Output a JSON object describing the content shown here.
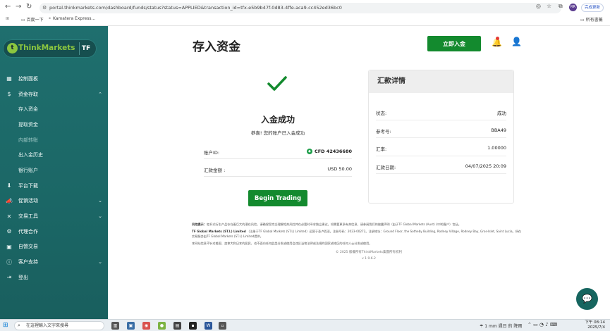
{
  "browser": {
    "url": "portal.thinkmarkets.com/dashboard/funds/status?status=APPLIED&transaction_id=tfx-e5b9b47f-0d83-4ffe-aca9-cc452ed36bc0",
    "bookmarks": [
      "百度一下",
      "Kamatera Express..."
    ],
    "bookmarks_right": "所有書籤",
    "update_label": "完成更新",
    "profile_initial": "RR"
  },
  "sidebar": {
    "brand": "ThinkMarkets",
    "brand_mark": "TF",
    "items": [
      {
        "label": "控制面板",
        "icon": "▦"
      },
      {
        "label": "资金存取",
        "icon": "$",
        "chevron": "⌃"
      },
      {
        "label": "存入资金"
      },
      {
        "label": "提取资金"
      },
      {
        "label": "内部转账"
      },
      {
        "label": "出入金历史"
      },
      {
        "label": "银行账户"
      },
      {
        "label": "平台下载",
        "icon": "⬇"
      },
      {
        "label": "促销活动",
        "icon": "📣",
        "chevron": "⌄"
      },
      {
        "label": "交易工具",
        "icon": "✕",
        "chevron": "⌄"
      },
      {
        "label": "代理合作",
        "icon": "⚙"
      },
      {
        "label": "自營交易",
        "icon": "▣"
      },
      {
        "label": "客户支持",
        "icon": "ⓘ",
        "chevron": "⌄"
      },
      {
        "label": "登出",
        "icon": "⇥"
      }
    ]
  },
  "header": {
    "title": "存入资金",
    "deposit_button": "立即入金"
  },
  "result": {
    "title": "入金成功",
    "message": "恭喜! 您的账户已入金成功",
    "account_label": "账户ID:",
    "account_value": "CFD 42436680",
    "amount_label": "汇款金额 :",
    "amount_value": "USD 50.00",
    "button": "Begin Trading"
  },
  "details": {
    "title": "汇款详情",
    "rows": [
      {
        "k": "状态:",
        "v": "成功"
      },
      {
        "k": "参考号:",
        "v": "BBA49"
      },
      {
        "k": "汇率:",
        "v": "1.00000"
      },
      {
        "k": "汇款日期:",
        "v": "04/07/2025 20:09"
      }
    ]
  },
  "disclaimer": {
    "p1_lead": "风险提示：",
    "p1": "杠杆式衍生产品存在着巨大的潜在风险，请确保您完全理解相关风险并在必要时寻求独立建议。如需要更多有关信息，请参阅我们的披露声明（由于TF Global Markets (Aust) Ltd的客户）包括。",
    "p2_lead": "TF Global Markets (ST.L) Limited",
    "p2": "（注册于TF Global Markets (ST.L) Limited）运营于圣卢西亚。注册号码：2023-00272。注册地址：Ground Floor, the Sotheby Building, Rodney Village, Rodney Bay, Gros-Islet, Saint Lucia。所在交易服务由TF Global Markets (ST.L) Limited提供。",
    "p3": "本网站信息不针对美国、加拿大和日本的居民，也不面向任何此类分发或使用会违反当地法律或法规的国家或地区的任何人士分发或使用。",
    "copyright": "© 2025 版權所有ThinkMarkets集團所有权利",
    "version": "v 1.9.6.2"
  },
  "taskbar": {
    "search_placeholder": "在這裡輸入文字來搜尋",
    "weather": "1 mm 週日 的 降雨",
    "time": "下午 08:14",
    "date": "2025/7/4"
  },
  "colors": {
    "brand_green": "#138a2e",
    "sidebar_teal": "#1f6f6e",
    "logo_lime": "#8cc63f"
  }
}
